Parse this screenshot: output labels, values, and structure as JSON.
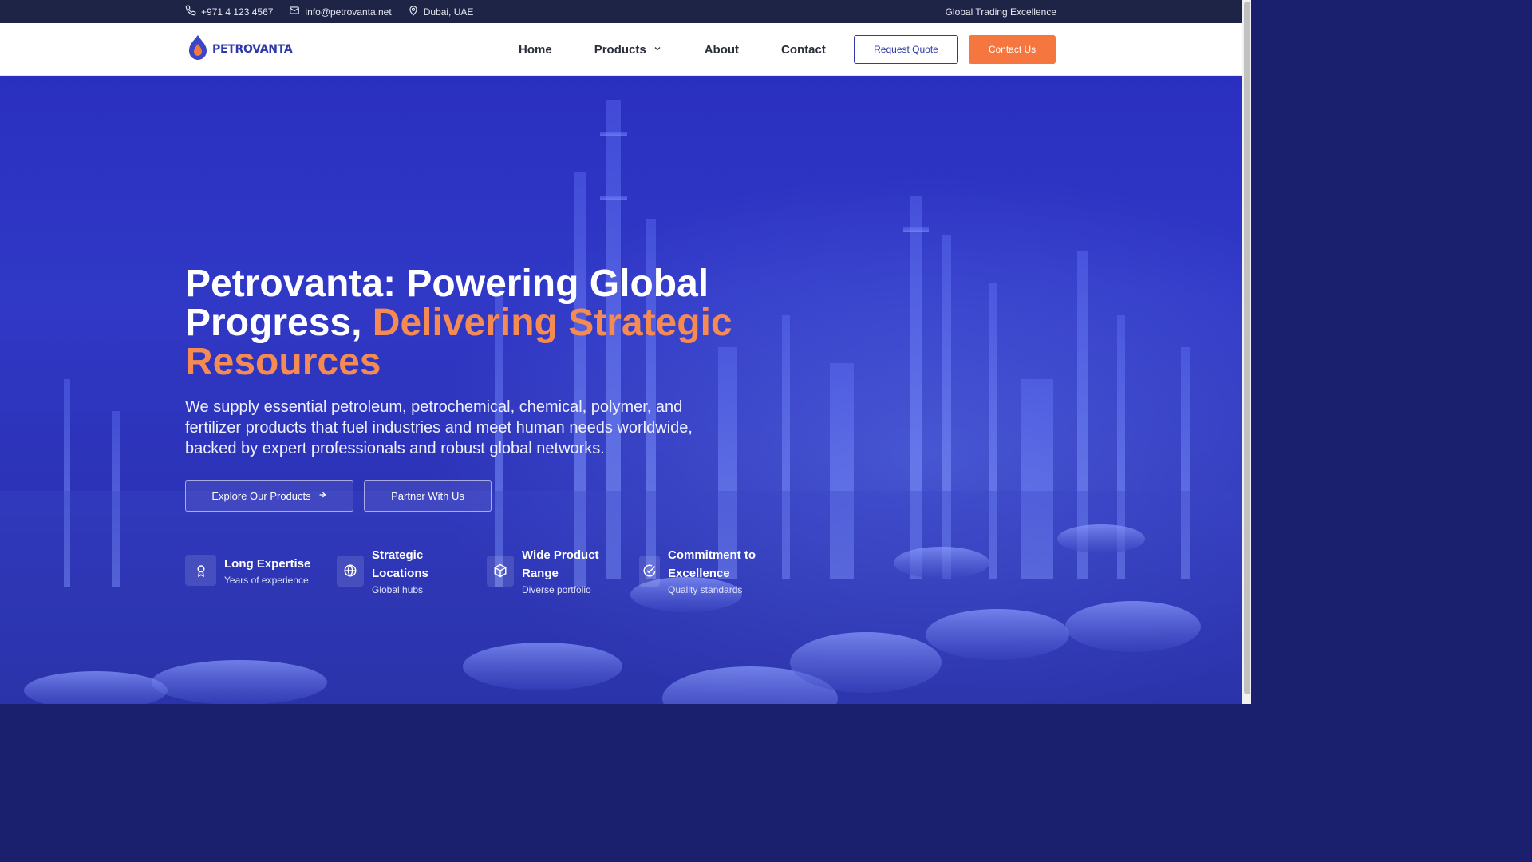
{
  "topbar": {
    "phone": "+971 4 123 4567",
    "email": "info@petrovanta.net",
    "location": "Dubai, UAE",
    "tagline": "Global Trading Excellence"
  },
  "nav": {
    "logo_text": "PETROVANTA",
    "items": [
      {
        "label": "Home"
      },
      {
        "label": "Products"
      },
      {
        "label": "About"
      },
      {
        "label": "Contact"
      }
    ],
    "request_quote": "Request Quote",
    "contact_us": "Contact Us"
  },
  "hero": {
    "headline_part1": "Petrovanta: Powering Global Progress, ",
    "headline_accent": "Delivering Strategic Resources",
    "subtext": "We supply essential petroleum, petrochemical, chemical, polymer, and fertilizer products that fuel industries and meet human needs worldwide, backed by expert professionals and robust global networks.",
    "cta_primary": "Explore Our Products",
    "cta_secondary": "Partner With Us",
    "features": [
      {
        "title": "Long Expertise",
        "subtitle": "Years of experience",
        "icon": "award-icon"
      },
      {
        "title": "Strategic Locations",
        "subtitle": "Global hubs",
        "icon": "globe-icon"
      },
      {
        "title": "Wide Product Range",
        "subtitle": "Diverse portfolio",
        "icon": "box-icon"
      },
      {
        "title": "Commitment to Excellence",
        "subtitle": "Quality standards",
        "icon": "check-circle-icon"
      }
    ]
  },
  "colors": {
    "brand_blue": "#2f3aa8",
    "accent_orange": "#f5763f",
    "topbar_bg": "#1e2446"
  }
}
